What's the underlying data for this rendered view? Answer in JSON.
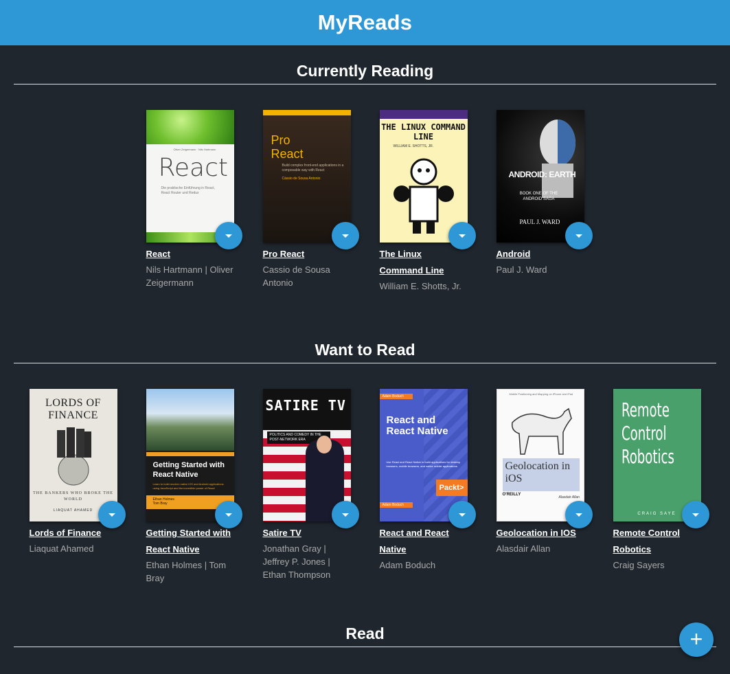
{
  "app": {
    "title": "MyReads"
  },
  "shelves": [
    {
      "title": "Currently Reading",
      "books": [
        {
          "title": "React",
          "authors": "Nils Hartmann | Oliver Zeigermann",
          "cover_text": "React"
        },
        {
          "title": "Pro React",
          "authors": "Cassio de Sousa Antonio",
          "cover_text": "Pro React"
        },
        {
          "title": "The Linux Command Line",
          "authors": "William E. Shotts, Jr.",
          "cover_text": "THE LINUX COMMAND LINE"
        },
        {
          "title": "Android",
          "authors": "Paul J. Ward",
          "cover_text": "ANDROID: EARTH",
          "cover_sub": "BOOK ONE OF THE ANDROID SAGA",
          "cover_author": "PAUL J. WARD"
        }
      ]
    },
    {
      "title": "Want to Read",
      "books": [
        {
          "title": "Lords of Finance",
          "authors": "Liaquat Ahamed",
          "cover_text": "LORDS OF FINANCE",
          "cover_sub": "THE BANKERS WHO BROKE THE WORLD",
          "cover_author": "LIAQUAT AHAMED"
        },
        {
          "title": "Getting Started with React Native",
          "authors": "Ethan Holmes | Tom Bray",
          "cover_text": "Getting Started with React Native",
          "cover_author": "Ethan Holmes Tom Bray"
        },
        {
          "title": "Satire TV",
          "authors": "Jonathan Gray | Jeffrey P. Jones | Ethan Thompson",
          "cover_text": "SATIRE TV",
          "cover_sub": "POLITICS AND COMEDY IN THE POST-NETWORK ERA"
        },
        {
          "title": "React and React Native",
          "authors": "Adam Boduch",
          "cover_text": "React and React Native",
          "cover_author": "Adam Boduch",
          "cover_brand": "Packt>"
        },
        {
          "title": "Geolocation in IOS",
          "authors": "Alasdair Allan",
          "cover_text": "Geolocation in iOS",
          "cover_brand": "O'REILLY"
        },
        {
          "title": "Remote Control Robotics",
          "authors": "Craig Sayers",
          "cover_text": "Remote Control Robotics",
          "cover_author": "CRAIG SAYE"
        }
      ]
    },
    {
      "title": "Read",
      "books": []
    }
  ],
  "icons": {
    "shelf_changer": "caret-down-icon",
    "add": "plus-icon"
  },
  "colors": {
    "header": "#2e97d6",
    "background": "#1f262e",
    "accent": "#2e97d6"
  },
  "add_button": {
    "label": "+"
  }
}
